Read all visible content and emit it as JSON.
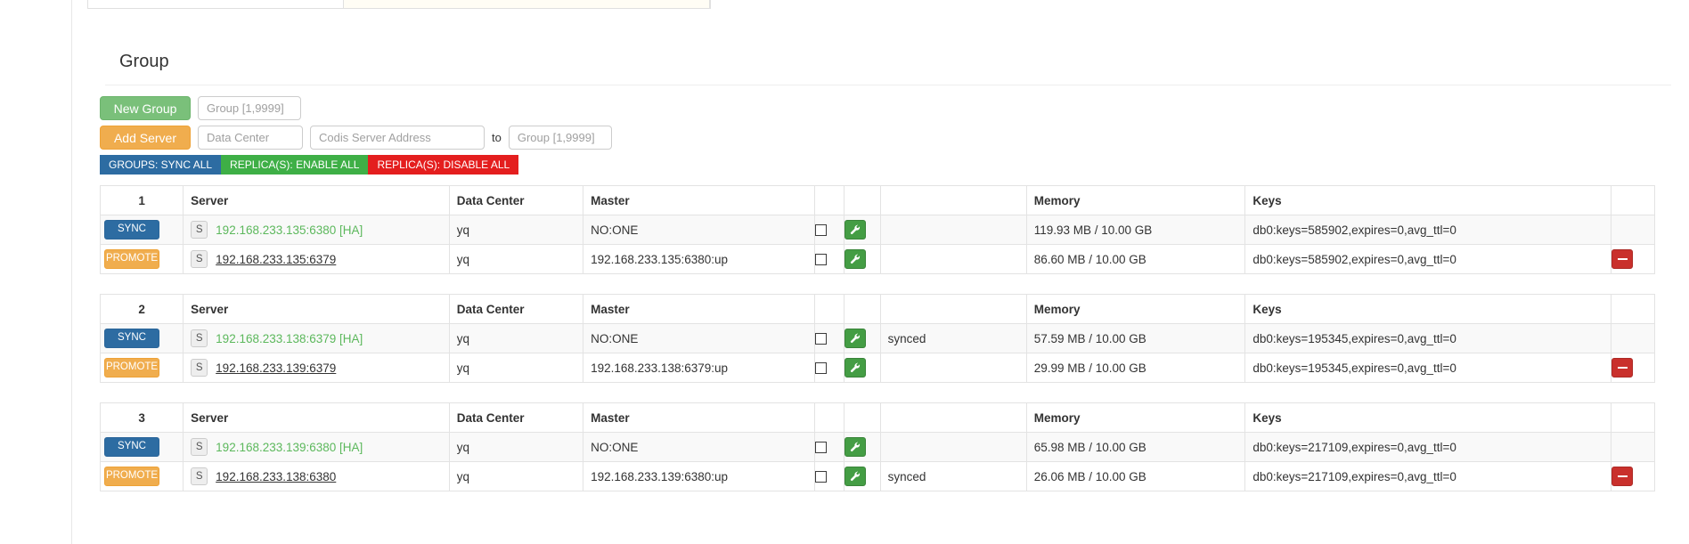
{
  "page": {
    "title": "Group"
  },
  "forms": {
    "new_group": {
      "button_label": "New Group",
      "group_id_placeholder": "Group [1,9999]",
      "group_id_value": ""
    },
    "add_server": {
      "button_label": "Add Server",
      "data_center_placeholder": "Data Center",
      "data_center_value": "",
      "server_address_placeholder": "Codis Server Address",
      "server_address_value": "",
      "to_label": "to",
      "to_group_placeholder": "Group [1,9999]",
      "to_group_value": ""
    }
  },
  "bulk_actions": [
    {
      "label": "GROUPS: SYNC ALL",
      "color": "#2d6ca2",
      "name": "groups-sync-all"
    },
    {
      "label": "REPLICA(S): ENABLE ALL",
      "color": "#3eaf46",
      "name": "replicas-enable-all"
    },
    {
      "label": "REPLICA(S): DISABLE ALL",
      "color": "#e41e1e",
      "name": "replicas-disable-all"
    }
  ],
  "table": {
    "columns": {
      "server": "Server",
      "data_center": "Data Center",
      "master": "Master",
      "memory": "Memory",
      "keys": "Keys"
    }
  },
  "groups": [
    {
      "id": "1",
      "rows": [
        {
          "action": "SYNC",
          "action_type": "sync",
          "badge": "S",
          "server": "192.168.233.135:6380 [HA]",
          "is_master": true,
          "data_center": "yq",
          "master": "NO:ONE",
          "checked": false,
          "state": "",
          "memory": "119.93 MB / 10.00 GB",
          "keys": "db0:keys=585902,expires=0,avg_ttl=0",
          "deletable": false
        },
        {
          "action": "PROMOTE",
          "action_type": "promote",
          "badge": "S",
          "server": "192.168.233.135:6379",
          "is_master": false,
          "data_center": "yq",
          "master": "192.168.233.135:6380:up",
          "checked": false,
          "state": "",
          "memory": "86.60 MB / 10.00 GB",
          "keys": "db0:keys=585902,expires=0,avg_ttl=0",
          "deletable": true
        }
      ]
    },
    {
      "id": "2",
      "rows": [
        {
          "action": "SYNC",
          "action_type": "sync",
          "badge": "S",
          "server": "192.168.233.138:6379 [HA]",
          "is_master": true,
          "data_center": "yq",
          "master": "NO:ONE",
          "checked": false,
          "state": "synced",
          "memory": "57.59 MB / 10.00 GB",
          "keys": "db0:keys=195345,expires=0,avg_ttl=0",
          "deletable": false
        },
        {
          "action": "PROMOTE",
          "action_type": "promote",
          "badge": "S",
          "server": "192.168.233.139:6379",
          "is_master": false,
          "data_center": "yq",
          "master": "192.168.233.138:6379:up",
          "checked": false,
          "state": "",
          "memory": "29.99 MB / 10.00 GB",
          "keys": "db0:keys=195345,expires=0,avg_ttl=0",
          "deletable": true
        }
      ]
    },
    {
      "id": "3",
      "rows": [
        {
          "action": "SYNC",
          "action_type": "sync",
          "badge": "S",
          "server": "192.168.233.139:6380 [HA]",
          "is_master": true,
          "data_center": "yq",
          "master": "NO:ONE",
          "checked": false,
          "state": "",
          "memory": "65.98 MB / 10.00 GB",
          "keys": "db0:keys=217109,expires=0,avg_ttl=0",
          "deletable": false
        },
        {
          "action": "PROMOTE",
          "action_type": "promote",
          "badge": "S",
          "server": "192.168.233.138:6380",
          "is_master": false,
          "data_center": "yq",
          "master": "192.168.233.139:6380:up",
          "checked": false,
          "state": "synced",
          "memory": "26.06 MB / 10.00 GB",
          "keys": "db0:keys=217109,expires=0,avg_ttl=0",
          "deletable": true
        }
      ]
    }
  ]
}
